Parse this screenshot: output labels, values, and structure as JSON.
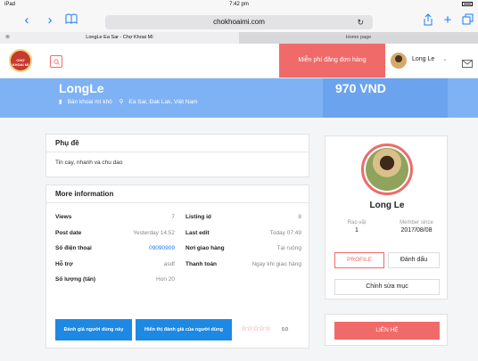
{
  "status_bar": {
    "device": "iPad",
    "time": "7:42 pm"
  },
  "browser": {
    "url": "chokhoaimi.com",
    "tabs": [
      {
        "label": "LongLe Ea Sar - Chợ Khoai Mì",
        "active": true
      },
      {
        "label": "Home page",
        "active": false
      }
    ]
  },
  "header": {
    "logo_text": "CHỢ KHOAI MÌ",
    "post_button": "Miễn phí đăng đơn hàng",
    "user_name": "Long Le",
    "user_chevron": "⌄"
  },
  "hero": {
    "name": "LongLe",
    "category": "Bán khoai mì khô",
    "location": "Ea Sar, Đak Lak, Việt Nam",
    "price": "970 VND"
  },
  "subtitle_card": {
    "title": "Phụ đề",
    "text": "Tin cay, nhanh va chu dao"
  },
  "info_card": {
    "title": "More information",
    "rows": [
      {
        "k1": "Views",
        "v1": "7",
        "k2": "Listing id",
        "v2": "8"
      },
      {
        "k1": "Post date",
        "v1": "Yesterday 14:52",
        "k2": "Last edit",
        "v2": "Today 07:49"
      },
      {
        "k1": "Số điện thoại",
        "v1": "09090909",
        "k2": "Nơi giao hàng",
        "v2": "Tại ruộng"
      },
      {
        "k1": "Hỗ trợ",
        "v1": "asdf",
        "k2": "Thanh toán",
        "v2": "Ngay khi giao hàng"
      },
      {
        "k1": "Số lượng (tấn)",
        "v1": "Hon 20",
        "k2": "",
        "v2": ""
      }
    ],
    "rate_button": "Đánh giá người dùng này",
    "view_rate_button": "Hiển thị đánh giá của người dùng",
    "stars": "☆☆☆☆☆",
    "rating_score": "0.0"
  },
  "profile": {
    "name": "Long Le",
    "posts_label": "Rao vặt",
    "posts_value": "1",
    "member_label": "Member since",
    "member_value": "2017/08/08",
    "profile_button": "PROFILE",
    "bookmark_button": "Đánh dấu",
    "edit_button": "Chỉnh sửa mục",
    "contact_button": "LIÊN HỆ"
  },
  "colors": {
    "accent": "#f06a6a",
    "hero": "#7fb2f5",
    "primary_button": "#1e88e5",
    "ios_blue": "#1a7cf5"
  }
}
